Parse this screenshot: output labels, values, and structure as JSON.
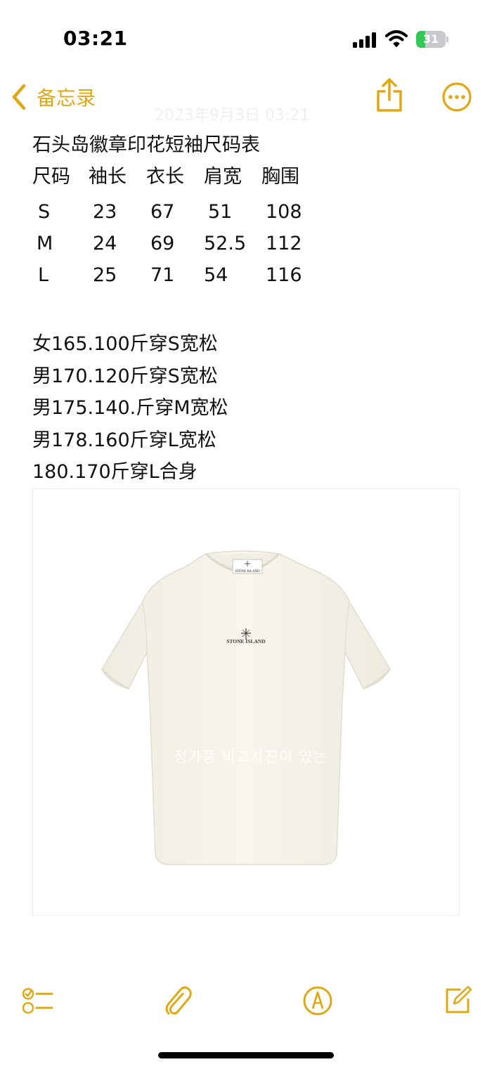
{
  "status_bar": {
    "time": "03:21",
    "battery_level": "31"
  },
  "nav": {
    "back_label": "备忘录",
    "faded_date": "2023年9月3日 03:21"
  },
  "note": {
    "title": "石头岛徽章印花短袖尺码表",
    "table": {
      "headers": [
        "尺码",
        "袖长",
        "衣长",
        "肩宽",
        "胸围"
      ],
      "rows": [
        [
          "S",
          "23",
          "67",
          "51",
          "108"
        ],
        [
          "M",
          "24",
          "69",
          "52.5",
          "112"
        ],
        [
          "L",
          "25",
          "71",
          "54",
          "116"
        ]
      ]
    },
    "recommendations": [
      "女165.100斤穿S宽松",
      "男170.120斤穿S宽松",
      "男175.140.斤穿M宽松",
      "男178.160斤穿L宽松",
      "180.170斤穿L合身"
    ]
  },
  "photo": {
    "logo_text": "STONE ISLAND",
    "label_text": "STONE ISLAND",
    "watermark": "정가품 비교사진이 있는"
  },
  "icons": {
    "signal": "signal-icon",
    "wifi": "wifi-icon",
    "back": "chevron-left-icon",
    "share": "share-icon",
    "more": "ellipsis-circle-icon",
    "checklist": "checklist-icon",
    "attachment": "paperclip-icon",
    "markup": "pen-circle-icon",
    "compose": "compose-icon"
  },
  "colors": {
    "accent": "#e2a814",
    "battery": "#34c759",
    "shirt": "#f6f4ea"
  }
}
